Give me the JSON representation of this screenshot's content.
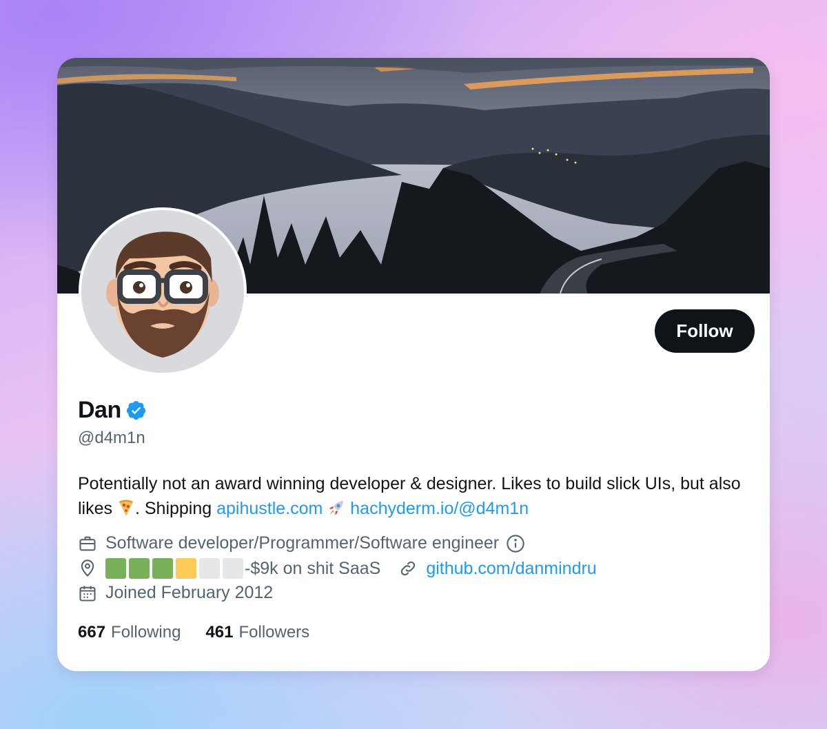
{
  "profile": {
    "name": "Dan",
    "handle": "@d4m1n",
    "follow_label": "Follow"
  },
  "bio": {
    "text_1": "Potentially not an award winning developer & designer. Likes to build slick UIs, but also likes",
    "text_2": ". Shipping",
    "link_1": "apihustle.com",
    "link_2": "hachyderm.io/@d4m1n",
    "pizza_emoji": "🍕",
    "rocket_emoji": "🚀"
  },
  "meta": {
    "profession": "Software developer/Programmer/Software engineer",
    "location_text": "-$9k on shit SaaS",
    "location_squares": [
      "🟩",
      "🟩",
      "🟩",
      "🟨",
      "⬜",
      "⬜"
    ],
    "website": "github.com/danmindru",
    "joined": "Joined February 2012"
  },
  "stats": {
    "following_count": "667",
    "following_label": "Following",
    "followers_count": "461",
    "followers_label": "Followers"
  },
  "colors": {
    "link": "#1d9bf0",
    "follow_button": "#0f1419",
    "secondary_text": "#536471",
    "square_green": "#78b159",
    "square_yellow": "#fdcb58",
    "square_white": "#e6e7e8"
  }
}
